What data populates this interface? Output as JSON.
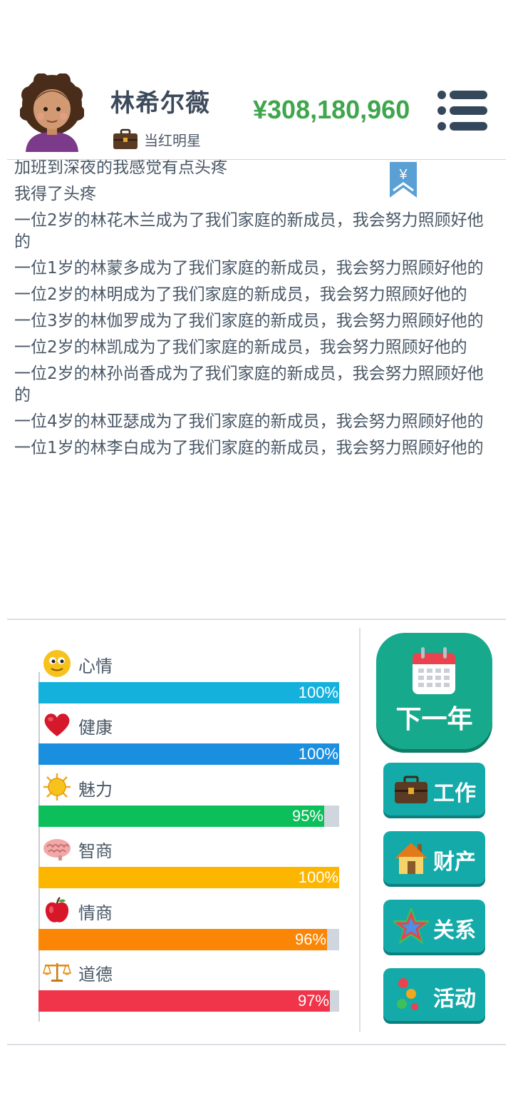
{
  "player": {
    "name": "林希尔薇",
    "job": "当红明星",
    "money": "¥308,180,960"
  },
  "log": [
    "加班到深夜的我感觉有点头疼",
    "我得了头疼",
    "一位2岁的林花木兰成为了我们家庭的新成员，我会努力照顾好他的",
    "一位1岁的林蒙多成为了我们家庭的新成员，我会努力照顾好他的",
    "一位2岁的林明成为了我们家庭的新成员，我会努力照顾好他的",
    "一位3岁的林伽罗成为了我们家庭的新成员，我会努力照顾好他的",
    "一位2岁的林凯成为了我们家庭的新成员，我会努力照顾好他的",
    "一位2岁的林孙尚香成为了我们家庭的新成员，我会努力照顾好他的",
    "一位4岁的林亚瑟成为了我们家庭的新成员，我会努力照顾好他的",
    "一位1岁的林李白成为了我们家庭的新成员，我会努力照顾好他的"
  ],
  "stats": [
    {
      "label": "心情",
      "value_text": "100%",
      "value": 100,
      "color": "#14b1dc",
      "icon": "smiley-icon"
    },
    {
      "label": "健康",
      "value_text": "100%",
      "value": 100,
      "color": "#1a8fe0",
      "icon": "heart-icon"
    },
    {
      "label": "魅力",
      "value_text": "95%",
      "value": 95,
      "color": "#0cbf5a",
      "icon": "sun-icon"
    },
    {
      "label": "智商",
      "value_text": "100%",
      "value": 100,
      "color": "#fdb600",
      "icon": "brain-icon"
    },
    {
      "label": "情商",
      "value_text": "96%",
      "value": 96,
      "color": "#fb8504",
      "icon": "apple-icon"
    },
    {
      "label": "道德",
      "value_text": "97%",
      "value": 97,
      "color": "#f0354a",
      "icon": "scale-icon"
    }
  ],
  "buttons": {
    "next_year": "下一年",
    "work": "工作",
    "property": "财产",
    "relations": "关系",
    "activities": "活动"
  },
  "bookmark_symbol": "¥"
}
